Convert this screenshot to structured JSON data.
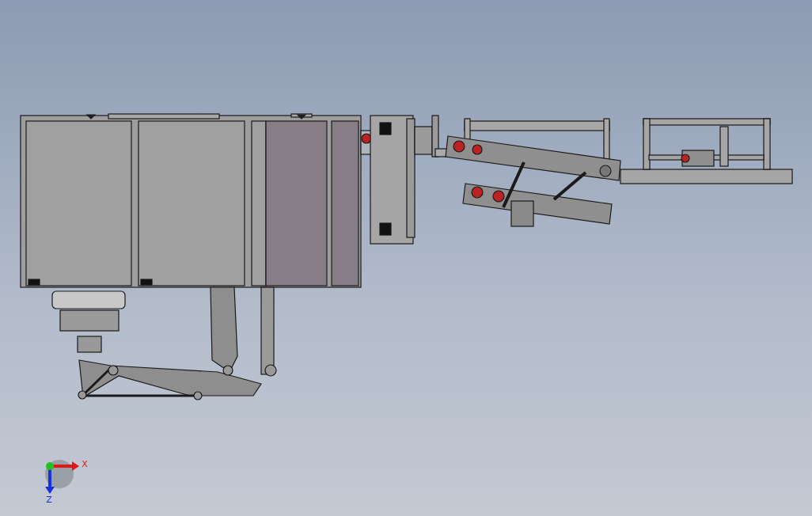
{
  "viewport": {
    "triad": {
      "axes": [
        {
          "kind": "x",
          "label": "X"
        },
        {
          "kind": "z",
          "label": "Z"
        }
      ]
    }
  }
}
